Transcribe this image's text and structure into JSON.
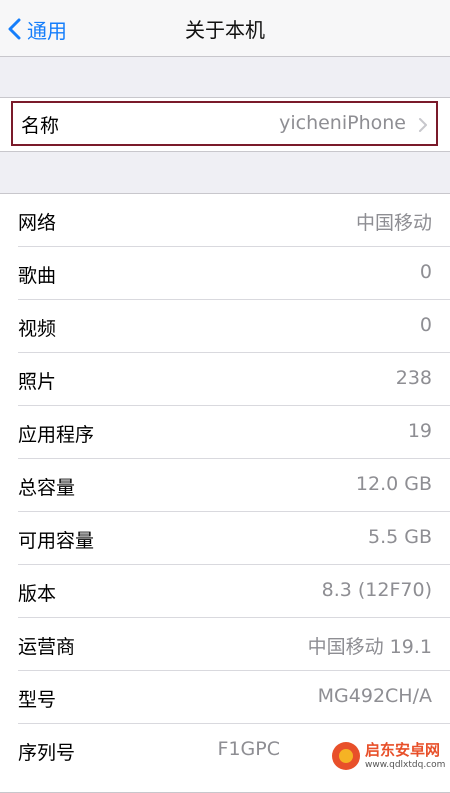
{
  "nav": {
    "back_label": "通用",
    "title": "关于本机"
  },
  "name_row": {
    "label": "名称",
    "value": "yicheniPhone"
  },
  "rows": [
    {
      "label": "网络",
      "value": "中国移动"
    },
    {
      "label": "歌曲",
      "value": "0"
    },
    {
      "label": "视频",
      "value": "0"
    },
    {
      "label": "照片",
      "value": "238"
    },
    {
      "label": "应用程序",
      "value": "19"
    },
    {
      "label": "总容量",
      "value": "12.0 GB"
    },
    {
      "label": "可用容量",
      "value": "5.5 GB"
    },
    {
      "label": "版本",
      "value": "8.3 (12F70)"
    },
    {
      "label": "运营商",
      "value": "中国移动 19.1"
    },
    {
      "label": "型号",
      "value": "MG492CH/A"
    },
    {
      "label": "序列号",
      "value": "F1GPC"
    }
  ],
  "watermark": {
    "name": "启东安卓网",
    "url": "www.qdlxtdq.com"
  },
  "colors": {
    "accent": "#157efb",
    "highlight_border": "#7a1a2a",
    "secondary_text": "#8e8e93",
    "background": "#efeff4"
  }
}
